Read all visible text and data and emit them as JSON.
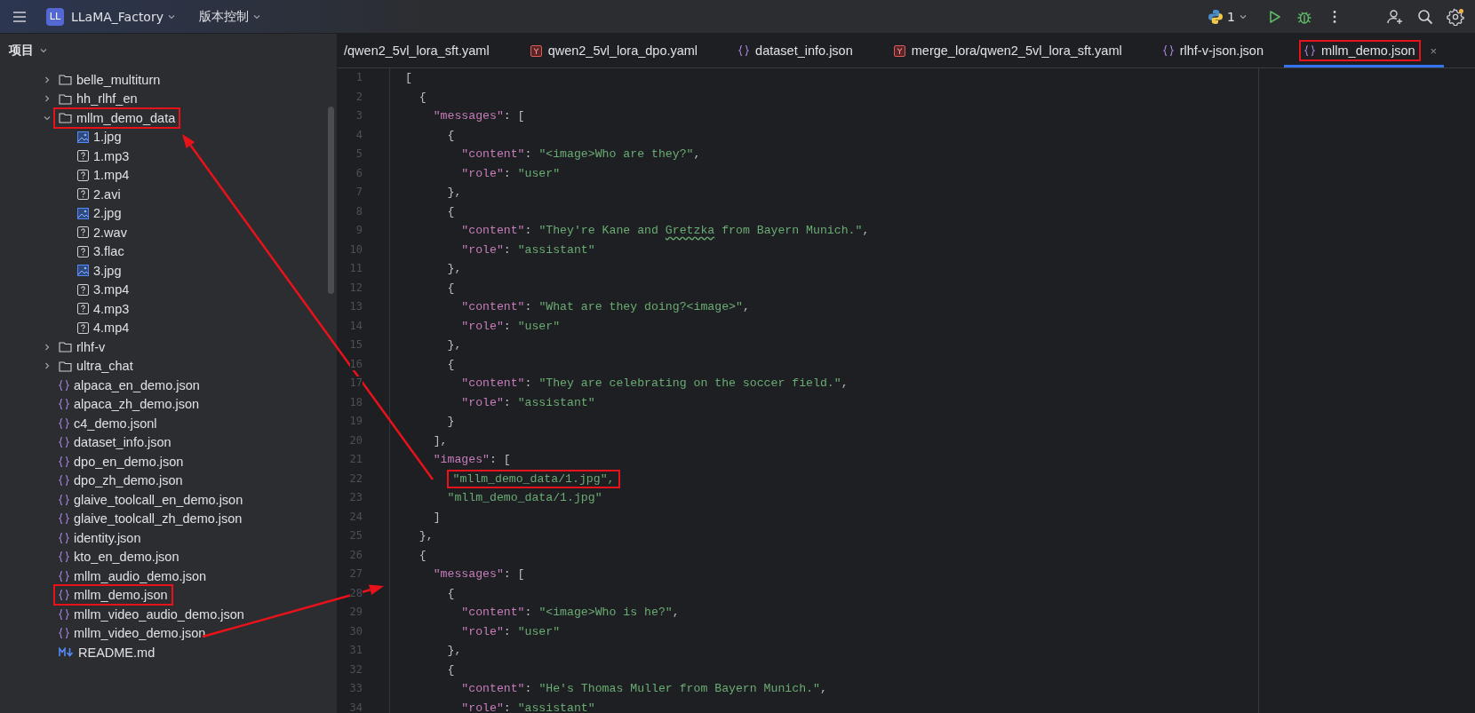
{
  "title_bar": {
    "project": {
      "badge": "LL",
      "name": "LLaMA_Factory"
    },
    "vcs_menu": "版本控制",
    "run_config": "1"
  },
  "sidebar": {
    "title": "项目",
    "tree": [
      {
        "kind": "folder",
        "name": "belle_multiturn",
        "expanded": false
      },
      {
        "kind": "folder",
        "name": "hh_rlhf_en",
        "expanded": false
      },
      {
        "kind": "folder",
        "name": "mllm_demo_data",
        "expanded": true,
        "annotated": true,
        "children": [
          {
            "kind": "image",
            "name": "1.jpg"
          },
          {
            "kind": "unknown",
            "name": "1.mp3"
          },
          {
            "kind": "unknown",
            "name": "1.mp4"
          },
          {
            "kind": "unknown",
            "name": "2.avi"
          },
          {
            "kind": "image",
            "name": "2.jpg"
          },
          {
            "kind": "unknown",
            "name": "2.wav"
          },
          {
            "kind": "unknown",
            "name": "3.flac"
          },
          {
            "kind": "image",
            "name": "3.jpg"
          },
          {
            "kind": "unknown",
            "name": "3.mp4"
          },
          {
            "kind": "unknown",
            "name": "4.mp3"
          },
          {
            "kind": "unknown",
            "name": "4.mp4"
          }
        ]
      },
      {
        "kind": "folder",
        "name": "rlhf-v",
        "expanded": false
      },
      {
        "kind": "folder",
        "name": "ultra_chat",
        "expanded": false
      },
      {
        "kind": "json",
        "name": "alpaca_en_demo.json"
      },
      {
        "kind": "json",
        "name": "alpaca_zh_demo.json"
      },
      {
        "kind": "json",
        "name": "c4_demo.jsonl"
      },
      {
        "kind": "json",
        "name": "dataset_info.json"
      },
      {
        "kind": "json",
        "name": "dpo_en_demo.json"
      },
      {
        "kind": "json",
        "name": "dpo_zh_demo.json"
      },
      {
        "kind": "json",
        "name": "glaive_toolcall_en_demo.json"
      },
      {
        "kind": "json",
        "name": "glaive_toolcall_zh_demo.json"
      },
      {
        "kind": "json",
        "name": "identity.json"
      },
      {
        "kind": "json",
        "name": "kto_en_demo.json"
      },
      {
        "kind": "json",
        "name": "mllm_audio_demo.json"
      },
      {
        "kind": "json",
        "name": "mllm_demo.json",
        "annotated": true
      },
      {
        "kind": "json",
        "name": "mllm_video_audio_demo.json"
      },
      {
        "kind": "json",
        "name": "mllm_video_demo.json"
      },
      {
        "kind": "markdown",
        "name": "README.md"
      }
    ]
  },
  "tabs": [
    {
      "kind": "none",
      "label": "/qwen2_5vl_lora_sft.yaml",
      "selected": false
    },
    {
      "kind": "yaml",
      "label": "qwen2_5vl_lora_dpo.yaml",
      "selected": false
    },
    {
      "kind": "json",
      "label": "dataset_info.json",
      "selected": false
    },
    {
      "kind": "yaml",
      "label": "merge_lora/qwen2_5vl_lora_sft.yaml",
      "selected": false
    },
    {
      "kind": "json",
      "label": "rlhf-v-json.json",
      "selected": false
    },
    {
      "kind": "json",
      "label": "mllm_demo.json",
      "selected": true,
      "annotated": true,
      "close": "×"
    }
  ],
  "editor": {
    "lines": [
      {
        "number": "1",
        "segments": [
          {
            "kind": "punct",
            "text": "["
          }
        ]
      },
      {
        "number": "2",
        "segments": [
          {
            "kind": "punct",
            "text": "  {"
          }
        ]
      },
      {
        "number": "3",
        "segments": [
          {
            "kind": "key",
            "text": "    \"messages\""
          },
          {
            "kind": "punct",
            "text": ": ["
          }
        ]
      },
      {
        "number": "4",
        "segments": [
          {
            "kind": "punct",
            "text": "      {"
          }
        ]
      },
      {
        "number": "5",
        "segments": [
          {
            "kind": "key",
            "text": "        \"content\""
          },
          {
            "kind": "punct",
            "text": ": "
          },
          {
            "kind": "string",
            "text": "\"<image>Who are they?\""
          },
          {
            "kind": "punct",
            "text": ","
          }
        ]
      },
      {
        "number": "6",
        "segments": [
          {
            "kind": "key",
            "text": "        \"role\""
          },
          {
            "kind": "punct",
            "text": ": "
          },
          {
            "kind": "string",
            "text": "\"user\""
          }
        ]
      },
      {
        "number": "7",
        "segments": [
          {
            "kind": "punct",
            "text": "      },"
          }
        ]
      },
      {
        "number": "8",
        "segments": [
          {
            "kind": "punct",
            "text": "      {"
          }
        ]
      },
      {
        "number": "9",
        "segments": [
          {
            "kind": "key",
            "text": "        \"content\""
          },
          {
            "kind": "punct",
            "text": ": "
          },
          {
            "kind": "string",
            "text": "\"They're Kane and "
          },
          {
            "kind": "string",
            "text": "Gretzka",
            "typo": true
          },
          {
            "kind": "string",
            "text": " from Bayern Munich.\""
          },
          {
            "kind": "punct",
            "text": ","
          }
        ]
      },
      {
        "number": "10",
        "segments": [
          {
            "kind": "key",
            "text": "        \"role\""
          },
          {
            "kind": "punct",
            "text": ": "
          },
          {
            "kind": "string",
            "text": "\"assistant\""
          }
        ]
      },
      {
        "number": "11",
        "segments": [
          {
            "kind": "punct",
            "text": "      },"
          }
        ]
      },
      {
        "number": "12",
        "segments": [
          {
            "kind": "punct",
            "text": "      {"
          }
        ]
      },
      {
        "number": "13",
        "segments": [
          {
            "kind": "key",
            "text": "        \"content\""
          },
          {
            "kind": "punct",
            "text": ": "
          },
          {
            "kind": "string",
            "text": "\"What are they doing?<image>\""
          },
          {
            "kind": "punct",
            "text": ","
          }
        ]
      },
      {
        "number": "14",
        "segments": [
          {
            "kind": "key",
            "text": "        \"role\""
          },
          {
            "kind": "punct",
            "text": ": "
          },
          {
            "kind": "string",
            "text": "\"user\""
          }
        ]
      },
      {
        "number": "15",
        "segments": [
          {
            "kind": "punct",
            "text": "      },"
          }
        ]
      },
      {
        "number": "16",
        "segments": [
          {
            "kind": "punct",
            "text": "      {"
          }
        ]
      },
      {
        "number": "17",
        "segments": [
          {
            "kind": "key",
            "text": "        \"content\""
          },
          {
            "kind": "punct",
            "text": ": "
          },
          {
            "kind": "string",
            "text": "\"They are celebrating on the soccer field.\""
          },
          {
            "kind": "punct",
            "text": ","
          }
        ]
      },
      {
        "number": "18",
        "segments": [
          {
            "kind": "key",
            "text": "        \"role\""
          },
          {
            "kind": "punct",
            "text": ": "
          },
          {
            "kind": "string",
            "text": "\"assistant\""
          }
        ]
      },
      {
        "number": "19",
        "segments": [
          {
            "kind": "punct",
            "text": "      }"
          }
        ]
      },
      {
        "number": "20",
        "segments": [
          {
            "kind": "punct",
            "text": "    ],"
          }
        ]
      },
      {
        "number": "21",
        "segments": [
          {
            "kind": "key",
            "text": "    \"images\""
          },
          {
            "kind": "punct",
            "text": ": ["
          }
        ]
      },
      {
        "number": "22",
        "segments": [
          {
            "kind": "string",
            "text": "      \"mllm_demo_data/1.jpg\",",
            "annotated": true
          }
        ]
      },
      {
        "number": "23",
        "segments": [
          {
            "kind": "string",
            "text": "      \"mllm_demo_data/1.jpg\""
          }
        ]
      },
      {
        "number": "24",
        "segments": [
          {
            "kind": "punct",
            "text": "    ]"
          }
        ]
      },
      {
        "number": "25",
        "segments": [
          {
            "kind": "punct",
            "text": "  },"
          }
        ]
      },
      {
        "number": "26",
        "segments": [
          {
            "kind": "punct",
            "text": "  {"
          }
        ]
      },
      {
        "number": "27",
        "segments": [
          {
            "kind": "key",
            "text": "    \"messages\""
          },
          {
            "kind": "punct",
            "text": ": ["
          }
        ]
      },
      {
        "number": "28",
        "segments": [
          {
            "kind": "punct",
            "text": "      {"
          }
        ]
      },
      {
        "number": "29",
        "segments": [
          {
            "kind": "key",
            "text": "        \"content\""
          },
          {
            "kind": "punct",
            "text": ": "
          },
          {
            "kind": "string",
            "text": "\"<image>Who is he?\""
          },
          {
            "kind": "punct",
            "text": ","
          }
        ]
      },
      {
        "number": "30",
        "segments": [
          {
            "kind": "key",
            "text": "        \"role\""
          },
          {
            "kind": "punct",
            "text": ": "
          },
          {
            "kind": "string",
            "text": "\"user\""
          }
        ]
      },
      {
        "number": "31",
        "segments": [
          {
            "kind": "punct",
            "text": "      },"
          }
        ]
      },
      {
        "number": "32",
        "segments": [
          {
            "kind": "punct",
            "text": "      {"
          }
        ]
      },
      {
        "number": "33",
        "segments": [
          {
            "kind": "key",
            "text": "        \"content\""
          },
          {
            "kind": "punct",
            "text": ": "
          },
          {
            "kind": "string",
            "text": "\"He's Thomas Muller from Bayern Munich.\""
          },
          {
            "kind": "punct",
            "text": ","
          }
        ]
      },
      {
        "number": "34",
        "segments": [
          {
            "kind": "key",
            "text": "        \"role\""
          },
          {
            "kind": "punct",
            "text": ": "
          },
          {
            "kind": "string",
            "text": "\"assistant\""
          }
        ]
      }
    ]
  }
}
